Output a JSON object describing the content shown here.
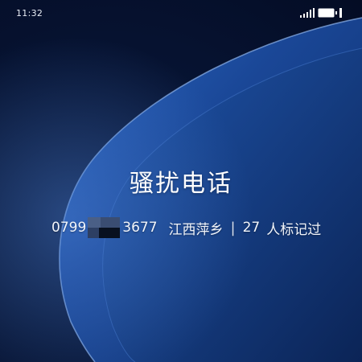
{
  "status_bar": {
    "time": "11:32",
    "icons": [
      "signal-icon",
      "battery-icon"
    ]
  },
  "call": {
    "label": "骚扰电话",
    "number_prefix": "0799",
    "number_suffix": "3677",
    "location": "江西萍乡",
    "separator": "|",
    "mark_count": "27",
    "mark_text": "人标记过"
  },
  "colors": {
    "background": "#071432",
    "wave": "#1b4fa6",
    "text": "#ffffff"
  }
}
